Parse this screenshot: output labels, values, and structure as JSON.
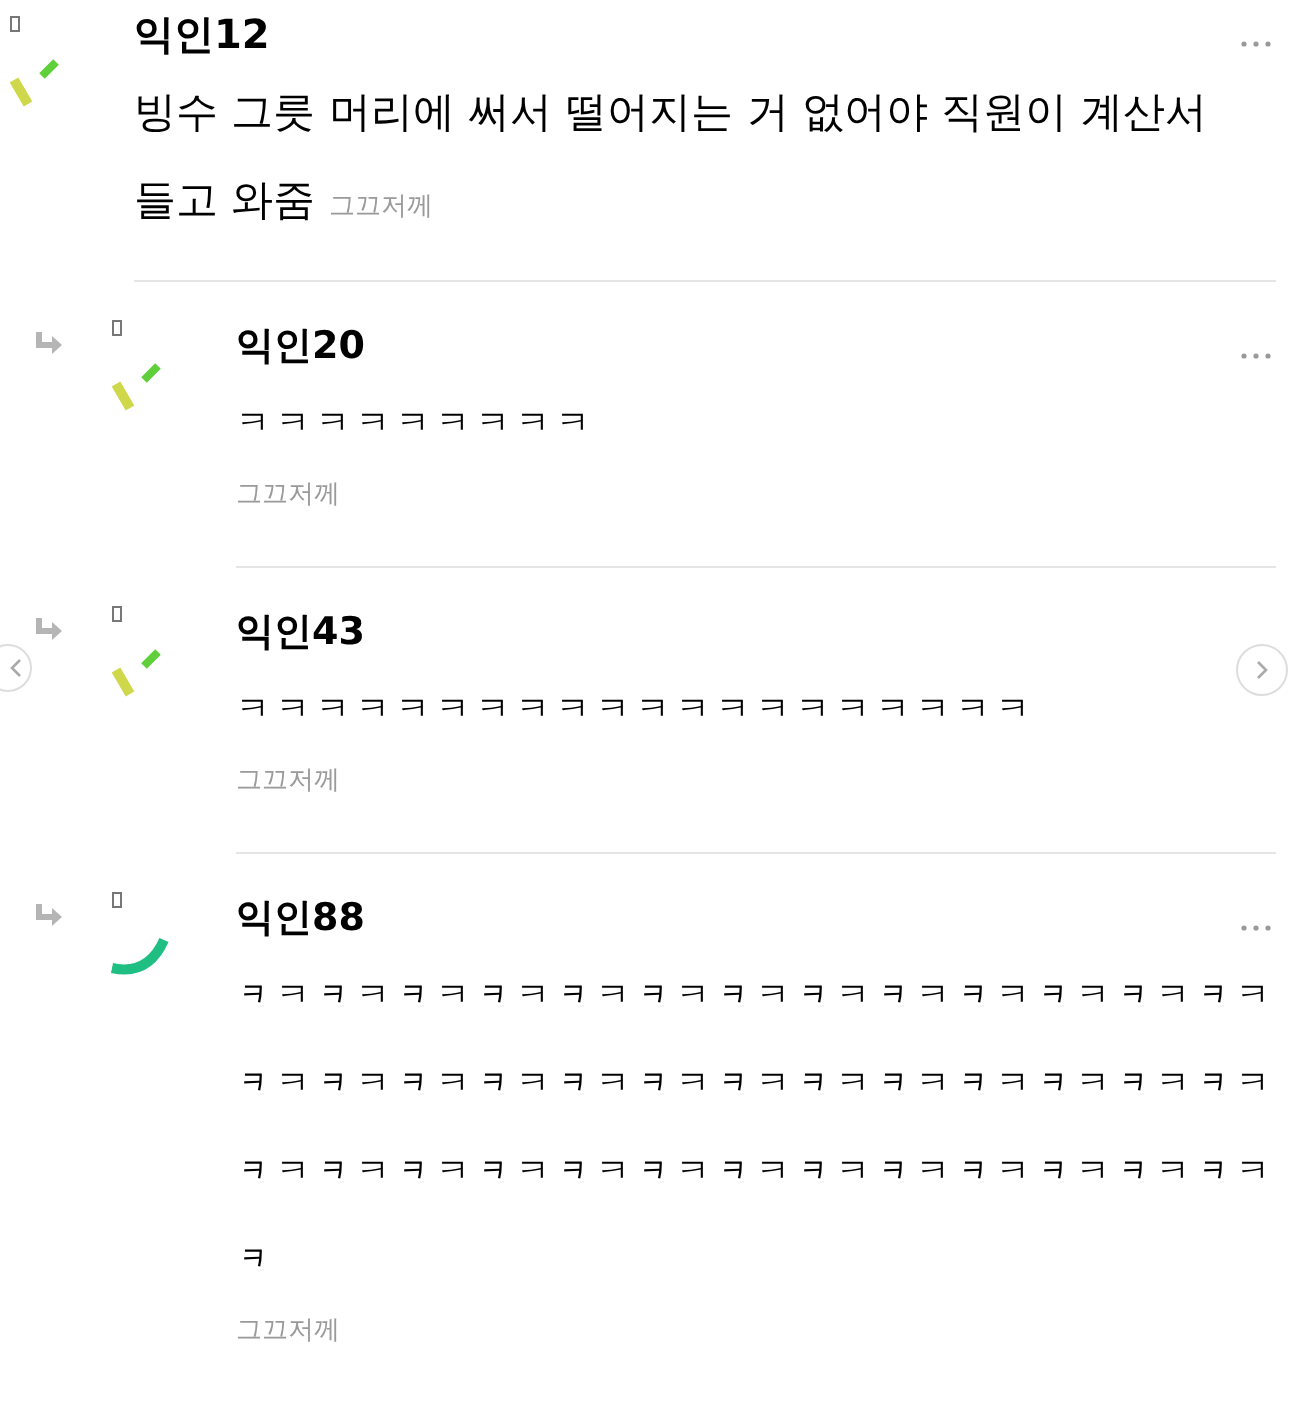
{
  "comments": [
    {
      "author": "익인12",
      "text": "빙수 그릇 머리에 써서 떨어지는 거 없어야 직원이 계산서 들고 와줌",
      "time": "그끄저께",
      "reply": false,
      "kind": "dashes",
      "menu": true
    },
    {
      "author": "익인20",
      "text": "ㅋㅋㅋㅋㅋㅋㅋㅋㅋ",
      "time": "그끄저께",
      "reply": true,
      "kind": "dashes",
      "menu": true
    },
    {
      "author": "익인43",
      "text": "ㅋㅋㅋㅋㅋㅋㅋㅋㅋㅋㅋㅋㅋㅋㅋㅋㅋㅋㅋㅋ",
      "time": "그끄저께",
      "reply": true,
      "kind": "dashes",
      "menu": false
    },
    {
      "author": "익인88",
      "text": "ᆿㅋᆿㅋᆿㅋᆿㅋᆿㅋᆿㅋᆿㅋᆿㅋᆿㅋᆿㅋᆿㅋᆿㅋᆿㅋᆿㅋᆿㅋᆿㅋᆿㅋᆿㅋᆿㅋᆿㅋᆿㅋᆿㅋᆿㅋᆿㅋᆿㅋᆿㅋᆿㅋᆿㅋᆿㅋᆿㅋᆿㅋᆿㅋᆿㅋᆿㅋᆿㅋᆿㅋᆿㅋᆿㅋᆿㅋᆿ",
      "time": "그끄저께",
      "reply": true,
      "kind": "arc",
      "menu": true
    }
  ]
}
